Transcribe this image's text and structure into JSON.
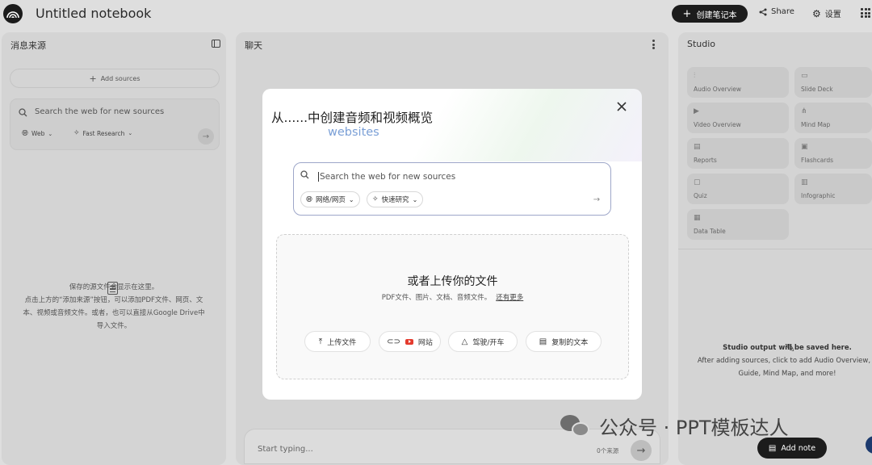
{
  "header": {
    "notebook_title": "Untitled notebook",
    "create_label": "创建笔记本",
    "share_label": "Share",
    "settings_label": "设置"
  },
  "sources": {
    "title": "消息来源",
    "add_label": "Add sources",
    "search_placeholder": "Search the web for new sources",
    "web_chip": "Web",
    "research_chip": "Fast Research",
    "empty_line1": "保存的源文件会显示在这里。",
    "empty_line2": "点击上方的“添加来源”按钮，可以添加PDF文件、网页、文",
    "empty_line3": "本、视频或音频文件。或者，也可以直接从Google Drive中",
    "empty_line4": "导入文件。"
  },
  "chat": {
    "title": "聊天",
    "input_placeholder": "Start typing...",
    "source_count": "0个来源"
  },
  "studio": {
    "title": "Studio",
    "tools": [
      "Audio Overview",
      "Slide Deck",
      "Video Overview",
      "Mind Map",
      "Reports",
      "Flashcards",
      "Quiz",
      "Infographic",
      "Data Table"
    ],
    "empty_title": "Studio output will be saved here.",
    "empty_line1": "After adding sources, click to add Audio Overview, S",
    "empty_line2": "Guide, Mind Map, and more!",
    "add_note_label": "Add note"
  },
  "modal": {
    "title": "从......中创建音频和视频概览",
    "subtitle": "websites",
    "search_placeholder": "Search the web for new sources",
    "web_chip": "网络/网页",
    "research_chip": "快速研究",
    "upload_heading": "或者上传你的文件",
    "upload_desc": "PDF文件、图片、文档、音频文件。",
    "more_link": "还有更多",
    "buttons": [
      "上传文件",
      "网站",
      "驾驶/开车",
      "复制的文本"
    ]
  },
  "watermark": "公众号 · PPT模板达人"
}
